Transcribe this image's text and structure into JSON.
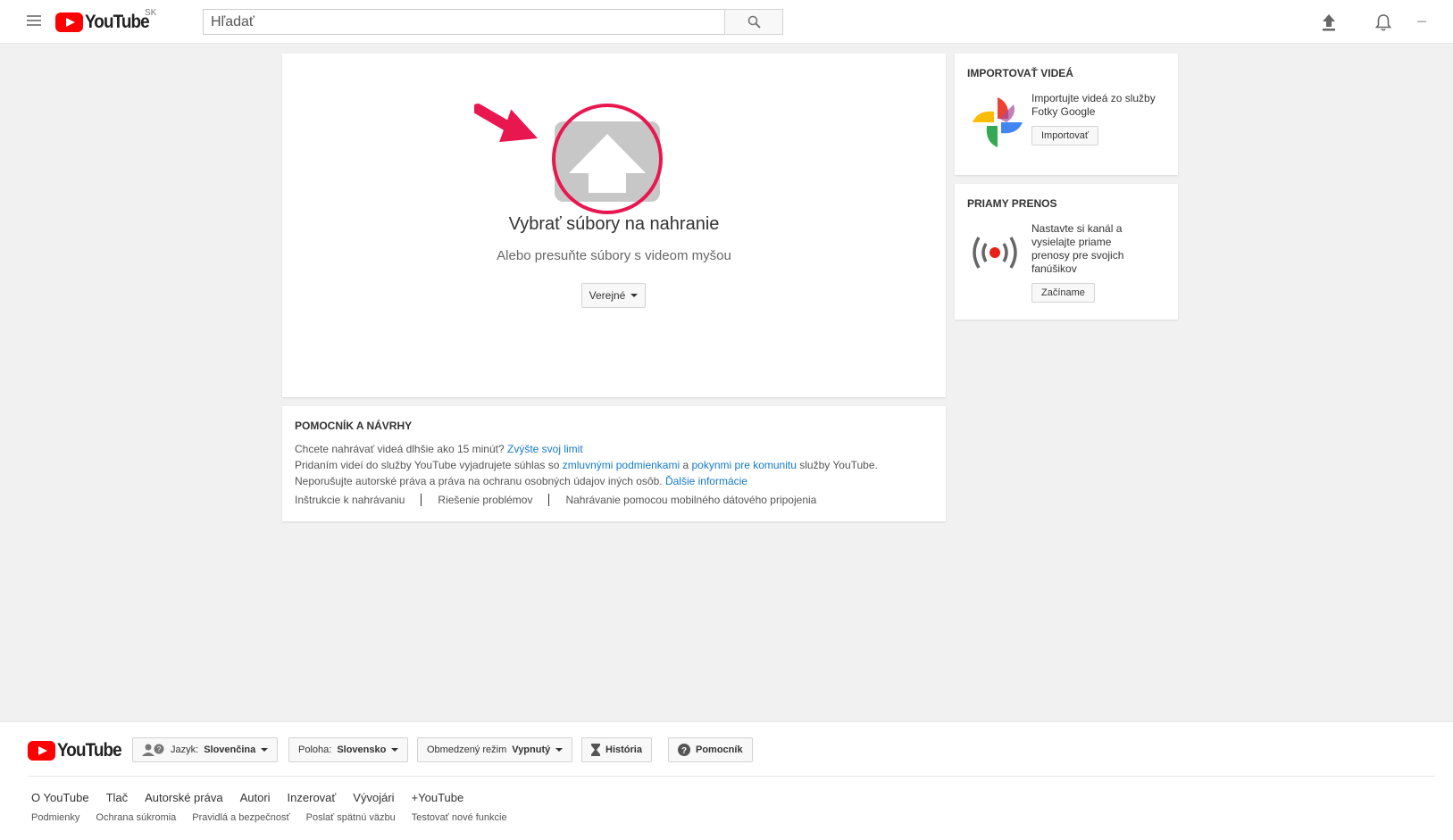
{
  "header": {
    "logo_text": "YouTube",
    "country_code": "SK",
    "search_placeholder": "Hľadať"
  },
  "upload": {
    "title": "Vybrať súbory na nahranie",
    "subtitle": "Alebo presuňte súbory s videom myšou",
    "privacy_label": "Verejné"
  },
  "help": {
    "title": "POMOCNÍK A NÁVRHY",
    "line1_text": "Chcete nahrávať videá dlhšie ako 15 minút?",
    "line1_link": "Zvýšte svoj limit",
    "line2_text_a": "Pridaním videí do služby YouTube vyjadrujete súhlas so",
    "line2_link_a": "zmluvnými podmienkami",
    "line2_text_b": "a",
    "line2_link_b": "pokynmi pre komunitu",
    "line2_text_c": "služby YouTube.",
    "line3_text": "Neporušujte autorské práva a práva na ochranu osobných údajov iných osôb.",
    "line3_link": "Ďalšie informácie",
    "links": [
      "Inštrukcie k nahrávaniu",
      "Riešenie problémov",
      "Nahrávanie pomocou mobilného dátového pripojenia"
    ]
  },
  "import_card": {
    "title": "IMPORTOVAŤ VIDEÁ",
    "text": "Importujte videá zo služby Fotky Google",
    "button": "Importovať"
  },
  "live_card": {
    "title": "PRIAMY PRENOS",
    "text": "Nastavte si kanál a vysielajte priame prenosy pre svojich fanúšikov",
    "button": "Začíname"
  },
  "footer": {
    "logo_text": "YouTube",
    "language_label": "Jazyk:",
    "language_value": "Slovenčina",
    "location_label": "Poloha:",
    "location_value": "Slovensko",
    "restricted_label": "Obmedzený režim",
    "restricted_value": "Vypnutý",
    "history": "História",
    "help": "Pomocník",
    "links_primary": [
      "O YouTube",
      "Tlač",
      "Autorské práva",
      "Autori",
      "Inzerovať",
      "Vývojári",
      "+YouTube"
    ],
    "links_secondary": [
      "Podmienky",
      "Ochrana súkromia",
      "Pravidlá a bezpečnosť",
      "Poslať spätnú väzbu",
      "Testovať nové funkcie"
    ]
  },
  "colors": {
    "brand_red": "#ff0000",
    "link_blue": "#167ac6",
    "annotation_pink": "#e8174f"
  }
}
